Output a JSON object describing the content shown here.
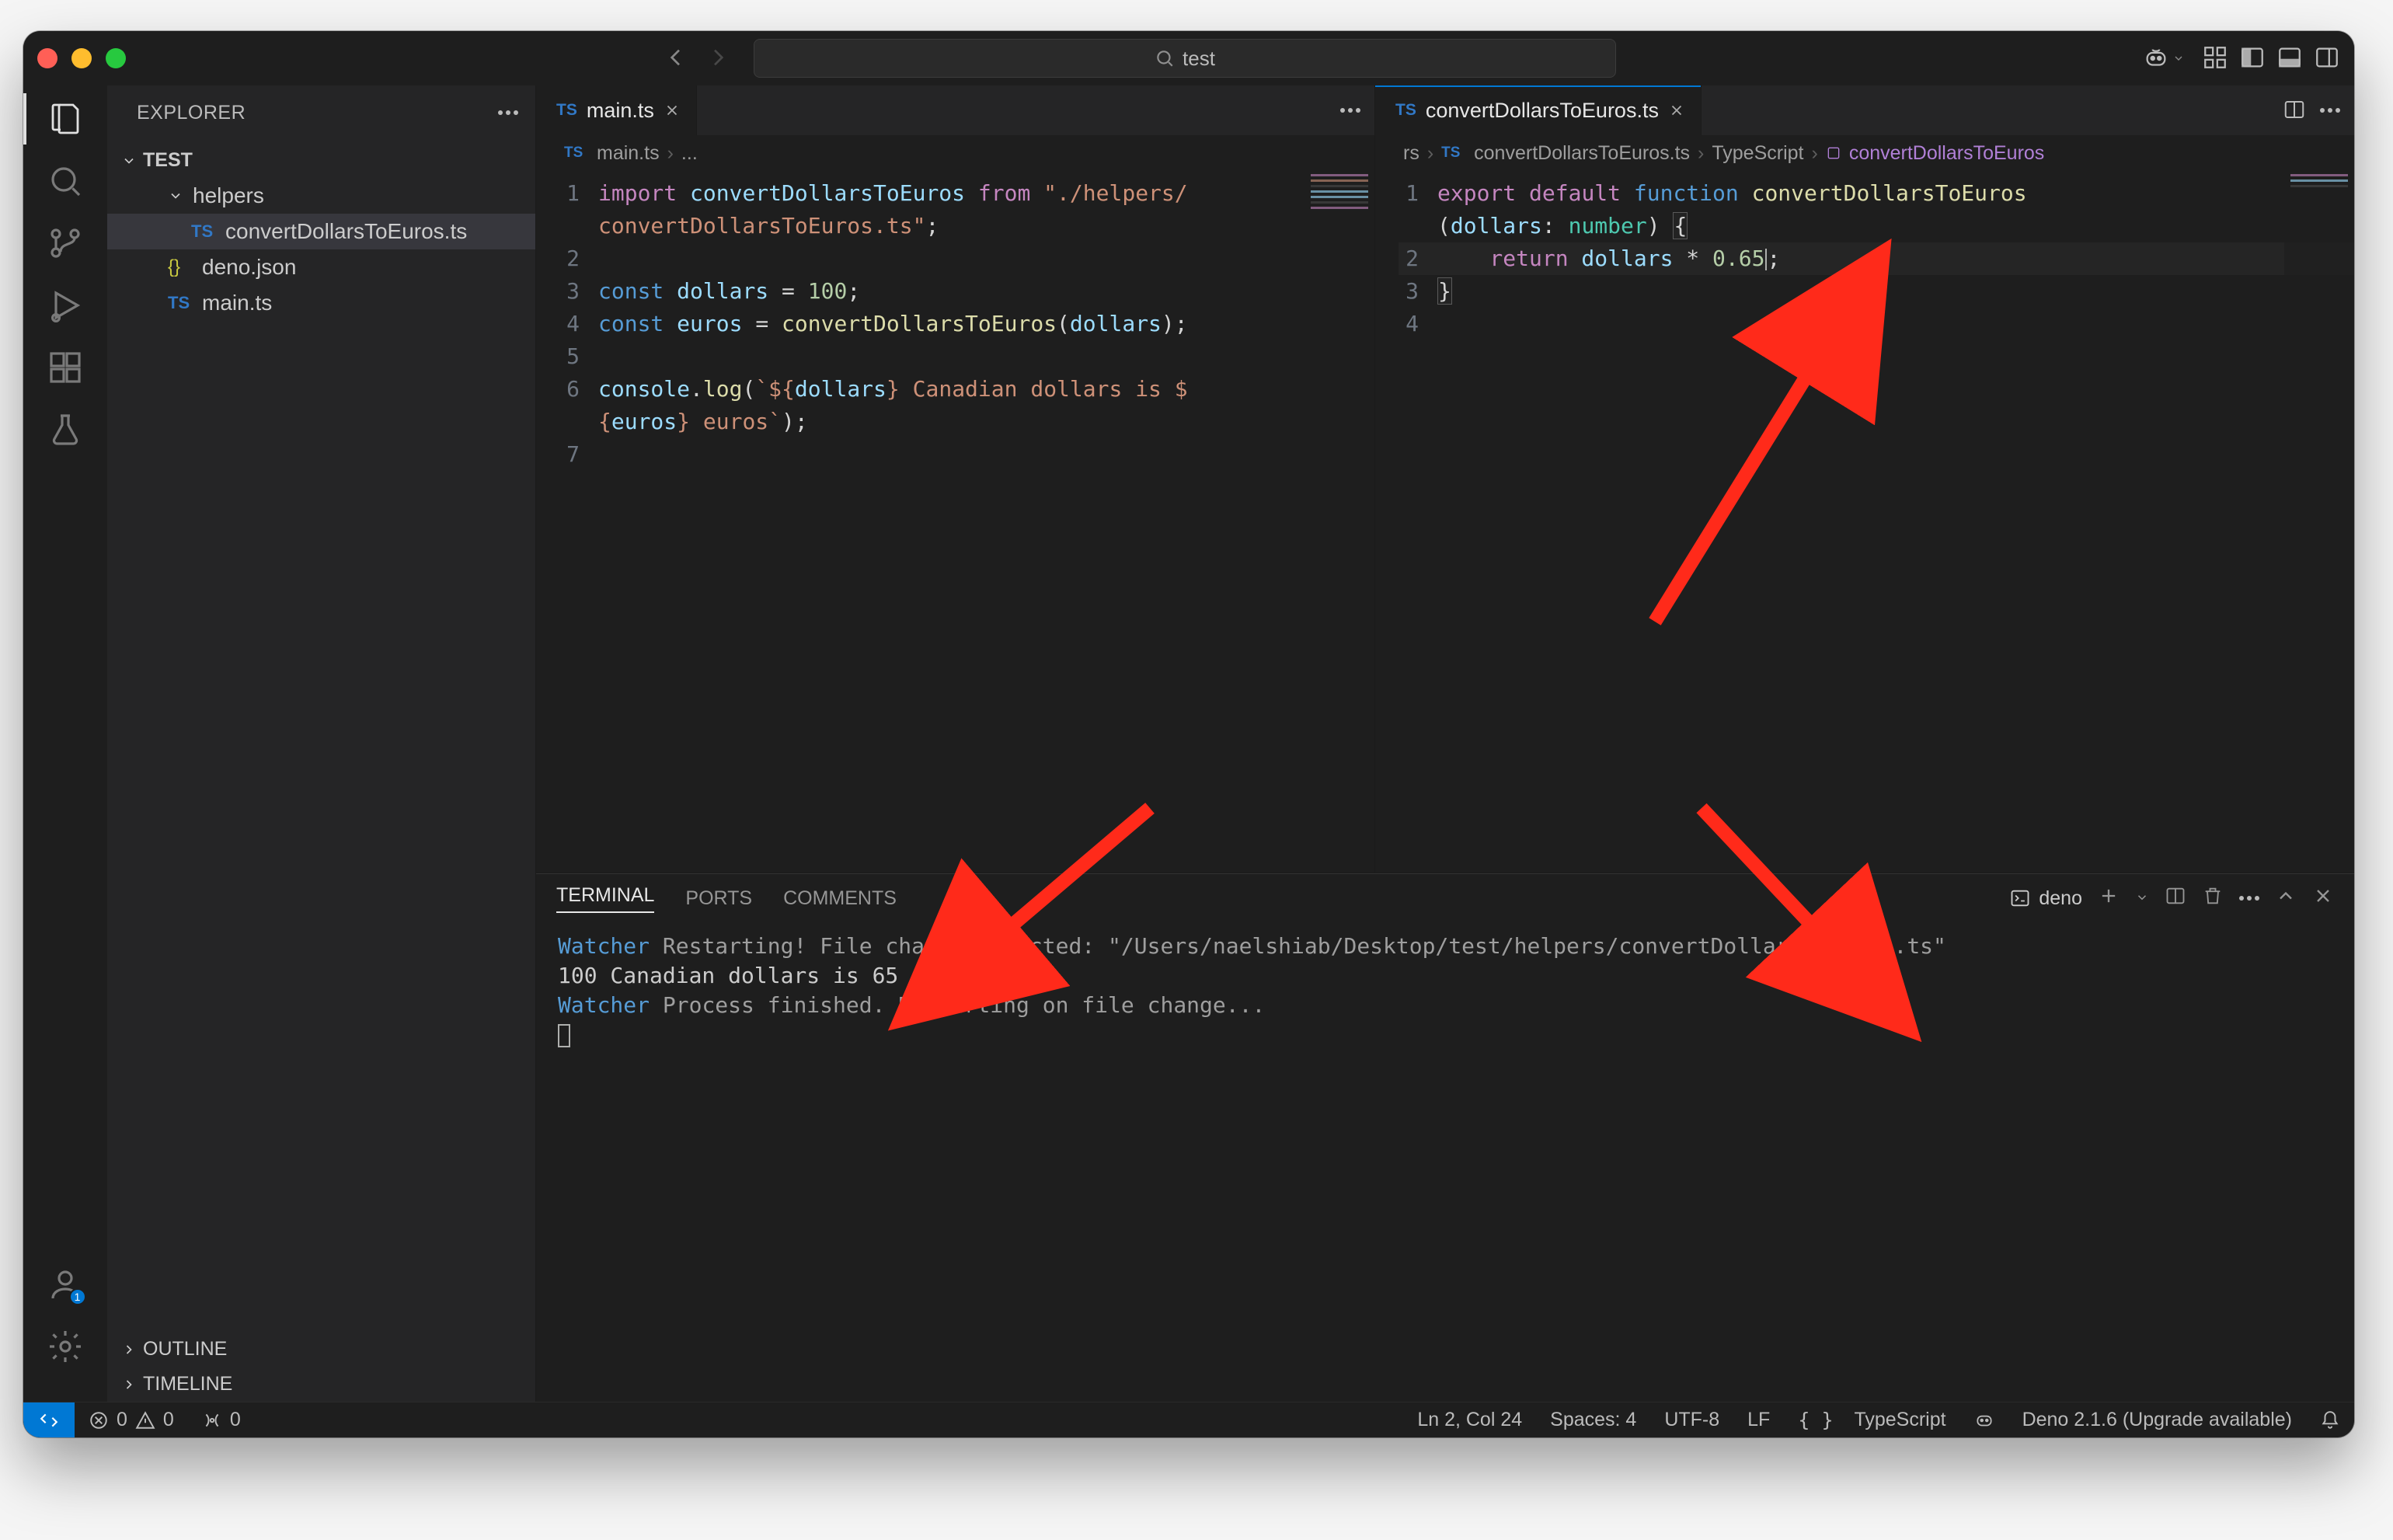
{
  "search_text": "test",
  "explorer": {
    "title": "EXPLORER",
    "project": "TEST",
    "folder": "helpers",
    "file_selected": "convertDollarsToEuros.ts",
    "file_deno": "deno.json",
    "file_main": "main.ts",
    "outline": "OUTLINE",
    "timeline": "TIMELINE",
    "account_badge": "1"
  },
  "tabs": {
    "left": "main.ts",
    "right": "convertDollarsToEuros.ts"
  },
  "breadcrumbs": {
    "left_1": "main.ts",
    "left_2": "...",
    "right_0": "rs",
    "right_1": "convertDollarsToEuros.ts",
    "right_2": "TypeScript",
    "right_3": "convertDollarsToEuros"
  },
  "code_left": {
    "l1a": "import",
    "l1b": " convertDollarsToEuros ",
    "l1c": "from",
    "l1d": " \"./helpers/",
    "l1e": "convertDollarsToEuros.ts\"",
    "l1f": ";",
    "l3a": "const",
    "l3b": " dollars ",
    "l3c": "= ",
    "l3d": "100",
    "l3e": ";",
    "l4a": "const",
    "l4b": " euros ",
    "l4c": "= ",
    "l4d": "convertDollarsToEuros",
    "l4e": "(",
    "l4f": "dollars",
    "l4g": ");",
    "l6a": "console",
    "l6b": ".",
    "l6c": "log",
    "l6d": "(",
    "l6e": "`${",
    "l6f": "dollars",
    "l6g": "} Canadian dollars is $",
    "l6h": "{",
    "l6i": "euros",
    "l6j": "} euros`",
    "l6k": ");"
  },
  "code_right": {
    "l1a": "export",
    "l1b": " default",
    "l1c": " function",
    "l1d": " convertDollarsToEuros",
    "l1e": "(",
    "l1f": "dollars",
    "l1g": ": ",
    "l1h": "number",
    "l1i": ") ",
    "l1j": "{",
    "l2a": "    return",
    "l2b": " dollars ",
    "l2c": "* ",
    "l2d": "0.65",
    "l2e": ";",
    "l3a": "}"
  },
  "line_numbers": {
    "n1": "1",
    "n2": "2",
    "n3": "3",
    "n4": "4",
    "n5": "5",
    "n6": "6",
    "n7": "7"
  },
  "panel": {
    "tab_terminal": "TERMINAL",
    "tab_ports": "PORTS",
    "tab_comments": "COMMENTS",
    "shell": "deno"
  },
  "terminal": {
    "l1a": "Watcher",
    "l1b": " Restarting! File change detected: \"/Users/naelshiab/Desktop/test/helpers/convertDollarsToEuros.ts\"",
    "l2": "100 Canadian dollars is 65 euros",
    "l3a": "Watcher",
    "l3b": " Process finished. Restarting on file change..."
  },
  "status": {
    "errors": "0",
    "warnings": "0",
    "ports": "0",
    "pos": "Ln 2, Col 24",
    "spaces": "Spaces: 4",
    "encoding": "UTF-8",
    "eol": "LF",
    "lang": "TypeScript",
    "deno": "Deno 2.1.6 (Upgrade available)"
  }
}
